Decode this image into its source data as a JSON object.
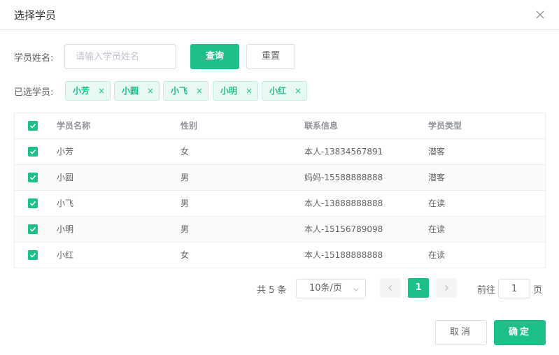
{
  "dialog": {
    "title": "选择学员"
  },
  "search": {
    "label": "学员姓名:",
    "placeholder": "请输入学员姓名",
    "value": "",
    "query_label": "查询",
    "reset_label": "重置"
  },
  "selected": {
    "label": "已选学员:",
    "tags": [
      "小芳",
      "小圆",
      "小飞",
      "小明",
      "小红"
    ],
    "close_glyph": "×"
  },
  "table": {
    "columns": [
      "学员名称",
      "性别",
      "联系信息",
      "学员类型"
    ],
    "rows": [
      {
        "name": "小芳",
        "gender": "女",
        "contact": "本人-13834567891",
        "type": "潜客",
        "checked": true
      },
      {
        "name": "小圆",
        "gender": "男",
        "contact": "妈妈-15588888888",
        "type": "潜客",
        "checked": true
      },
      {
        "name": "小飞",
        "gender": "男",
        "contact": "本人-13888888888",
        "type": "在读",
        "checked": true
      },
      {
        "name": "小明",
        "gender": "男",
        "contact": "本人-15156789098",
        "type": "在读",
        "checked": true
      },
      {
        "name": "小红",
        "gender": "女",
        "contact": "本人-15188888888",
        "type": "在读",
        "checked": true
      }
    ]
  },
  "pagination": {
    "total": "共 5 条",
    "page_size": "10条/页",
    "current_page": "1",
    "goto_label": "前往",
    "goto_value": "1",
    "goto_suffix": "页"
  },
  "footer": {
    "cancel_label": "取消",
    "confirm_label": "确定"
  },
  "colors": {
    "primary": "#1dbf8b",
    "tag_bg": "#e8f8f2",
    "border": "#dcdfe6"
  }
}
